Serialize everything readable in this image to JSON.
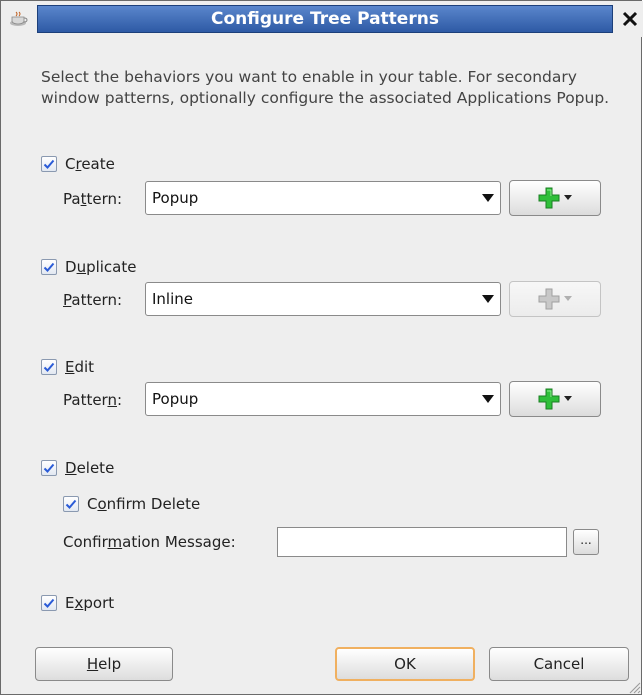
{
  "window": {
    "title": "Configure Tree Patterns",
    "close_glyph": "✕"
  },
  "intro": {
    "text": "Select the behaviors you want to enable in your table.  For secondary window patterns, optionally configure the associated Applications Popup."
  },
  "create": {
    "checked": true,
    "label_pre": "C",
    "label_mnemonic": "r",
    "label_post": "eate",
    "pattern_label_pre": "Pa",
    "pattern_label_mnemonic": "t",
    "pattern_label_post": "tern:",
    "pattern_value": "Popup",
    "add_enabled": true
  },
  "duplicate": {
    "checked": true,
    "label_pre": "D",
    "label_mnemonic": "u",
    "label_post": "plicate",
    "pattern_label_pre": "",
    "pattern_label_mnemonic": "P",
    "pattern_label_post": "attern:",
    "pattern_value": "Inline",
    "add_enabled": false
  },
  "edit": {
    "checked": true,
    "label_pre": "",
    "label_mnemonic": "E",
    "label_post": "dit",
    "pattern_label_pre": "Patter",
    "pattern_label_mnemonic": "n",
    "pattern_label_post": ":",
    "pattern_value": "Popup",
    "add_enabled": true
  },
  "delete": {
    "checked": true,
    "label_pre": "",
    "label_mnemonic": "D",
    "label_post": "elete",
    "confirm": {
      "checked": true,
      "label_pre": "C",
      "label_mnemonic": "o",
      "label_post": "nfirm Delete"
    },
    "message_label_pre": "Confir",
    "message_label_mnemonic": "m",
    "message_label_post": "ation Message:",
    "message_value": "",
    "browse_label": "..."
  },
  "export": {
    "checked": true,
    "label_pre": "E",
    "label_mnemonic": "x",
    "label_post": "port"
  },
  "footer": {
    "help_pre": "",
    "help_mnemonic": "H",
    "help_post": "elp",
    "ok_label": "OK",
    "cancel_label": "Cancel"
  },
  "colors": {
    "title_bar": "#2e5aa5",
    "add_icon_green": "#2fbf3a",
    "checkmark_blue": "#2a5bd7",
    "default_button_border": "#f0b060"
  },
  "icons": {
    "app": "coffee-cup-icon",
    "add": "plus-icon",
    "dropdown": "chevron-down-icon",
    "check": "checkmark-icon",
    "resize": "resize-grip-icon"
  }
}
